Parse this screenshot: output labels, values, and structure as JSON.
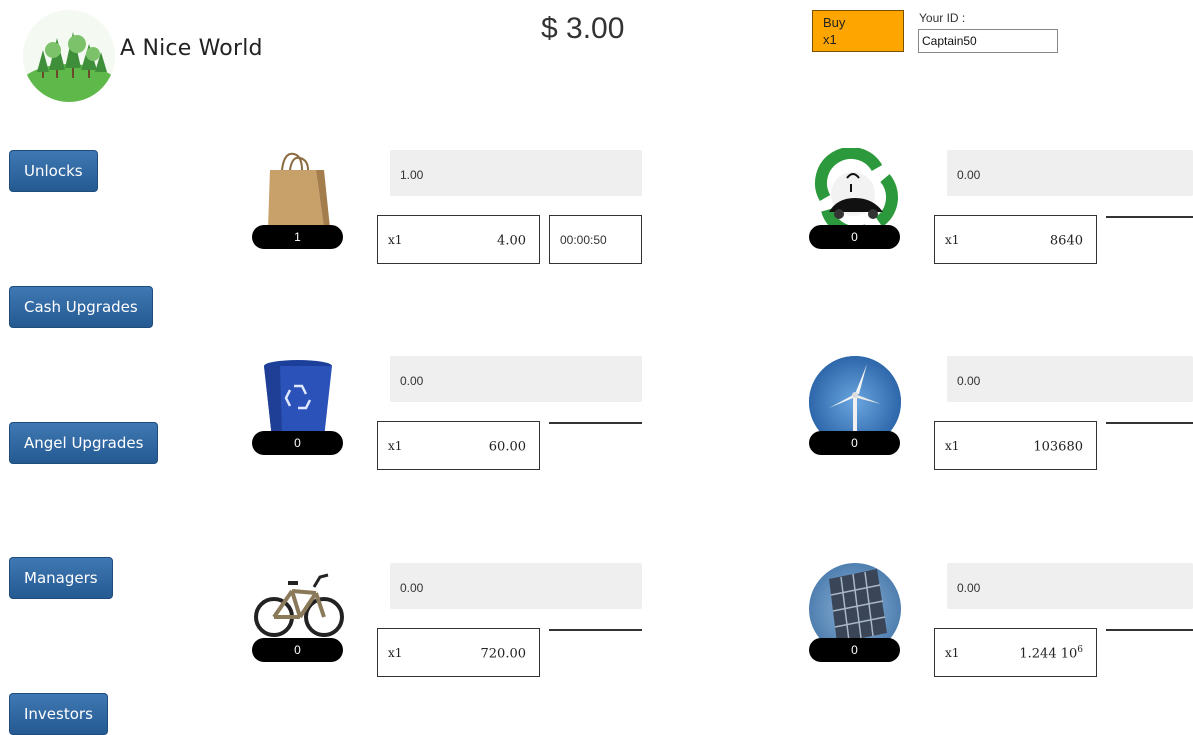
{
  "header": {
    "app_title": "A Nice World",
    "money": "$ 3.00",
    "buy_button": {
      "line1": "Buy",
      "line2": "x1"
    },
    "id_label": "Your ID :",
    "id_value": "Captain50"
  },
  "sidebar": {
    "buttons": [
      {
        "label": "Unlocks"
      },
      {
        "label": "Cash Upgrades"
      },
      {
        "label": "Angel Upgrades"
      },
      {
        "label": "Managers"
      },
      {
        "label": "Investors"
      }
    ]
  },
  "products": [
    {
      "icon": "paper-bag-icon",
      "count": "1",
      "progress_value": "1.00",
      "multiplier": "x1",
      "cost": "4.00",
      "cost_exp": "",
      "timer": "00:00:50"
    },
    {
      "icon": "electric-car-recycle-icon",
      "count": "0",
      "progress_value": "0.00",
      "multiplier": "x1",
      "cost": "8640",
      "cost_exp": "",
      "timer": ""
    },
    {
      "icon": "recycle-bin-icon",
      "count": "0",
      "progress_value": "0.00",
      "multiplier": "x1",
      "cost": "60.00",
      "cost_exp": "",
      "timer": ""
    },
    {
      "icon": "wind-turbine-icon",
      "count": "0",
      "progress_value": "0.00",
      "multiplier": "x1",
      "cost": "103680",
      "cost_exp": "",
      "timer": ""
    },
    {
      "icon": "bicycle-icon",
      "count": "0",
      "progress_value": "0.00",
      "multiplier": "x1",
      "cost": "720.00",
      "cost_exp": "",
      "timer": ""
    },
    {
      "icon": "solar-panel-icon",
      "count": "0",
      "progress_value": "0.00",
      "multiplier": "x1",
      "cost": "1.244 10",
      "cost_exp": "6",
      "timer": ""
    }
  ],
  "colors": {
    "buy_button": "#ffa500",
    "sidebar_button": "#2d659f",
    "count_badge": "#000000",
    "progress_bg": "#efefef"
  }
}
